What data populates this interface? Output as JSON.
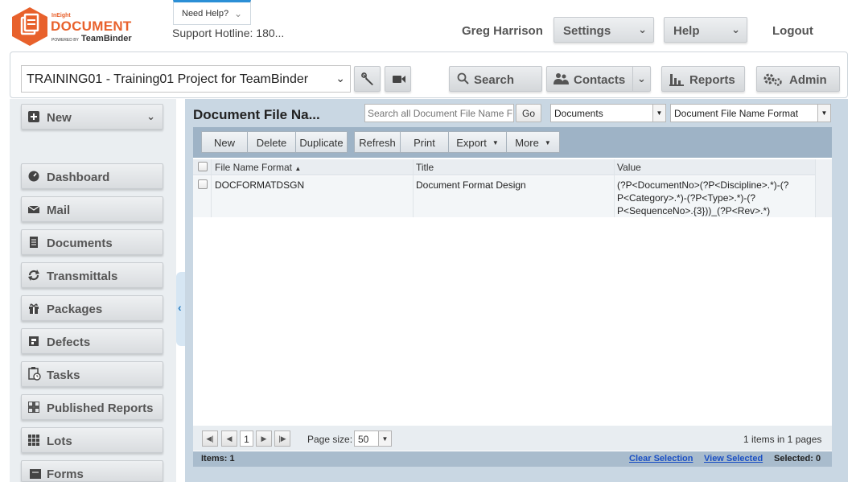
{
  "logo": {
    "small": "InEight",
    "big": "DOCUMENT",
    "powered": "POWERED BY",
    "teambinder": "TeamBinder"
  },
  "help": {
    "need_help": "Need Help?",
    "hotline": "Support Hotline: 180..."
  },
  "header": {
    "user": "Greg Harrison",
    "settings": "Settings",
    "help": "Help",
    "logout": "Logout"
  },
  "project": {
    "selected": "TRAINING01 - Training01 Project for TeamBinder"
  },
  "toolbar_top": {
    "search": "Search",
    "contacts": "Contacts",
    "reports": "Reports",
    "admin": "Admin"
  },
  "sidebar": {
    "new_label": "New",
    "items": [
      {
        "label": "Dashboard",
        "icon": "dashboard-icon"
      },
      {
        "label": "Mail",
        "icon": "mail-icon"
      },
      {
        "label": "Documents",
        "icon": "documents-icon"
      },
      {
        "label": "Transmittals",
        "icon": "transmittals-icon"
      },
      {
        "label": "Packages",
        "icon": "packages-icon"
      },
      {
        "label": "Defects",
        "icon": "defects-icon"
      },
      {
        "label": "Tasks",
        "icon": "tasks-icon"
      },
      {
        "label": "Published Reports",
        "icon": "published-reports-icon"
      },
      {
        "label": "Lots",
        "icon": "lots-icon"
      },
      {
        "label": "Forms",
        "icon": "forms-icon"
      }
    ]
  },
  "main": {
    "title": "Document File Na...",
    "search_placeholder": "Search all Document File Name Fo",
    "go": "Go",
    "module_select": "Documents",
    "view_select": "Document File Name Format"
  },
  "grid_toolbar": {
    "new": "New",
    "delete": "Delete",
    "duplicate": "Duplicate",
    "refresh": "Refresh",
    "print": "Print",
    "export": "Export",
    "more": "More"
  },
  "grid": {
    "columns": [
      "File Name Format",
      "Title",
      "Value"
    ],
    "rows": [
      {
        "file_name_format": "DOCFORMATDSGN",
        "title": "Document Format Design",
        "value_line1": "(?P<DocumentNo>(?P<Discipline>.*)-(?",
        "value_line2": "P<Category>.*)-(?P<Type>.*)-(?",
        "value_line3": "P<SequenceNo>.{3}))_(?P<Rev>.*)"
      }
    ]
  },
  "pager": {
    "current": "1",
    "page_size_label": "Page size:",
    "page_size": "50",
    "info": "1 items in 1 pages"
  },
  "status": {
    "items": "Items: 1",
    "clear_selection": "Clear Selection",
    "view_selected": "View Selected",
    "selected": "Selected: 0"
  },
  "colors": {
    "brand_orange": "#e8612c",
    "panel_blue": "#c9d7e3",
    "toolbar_blue": "#9eb3c6",
    "link_blue": "#1a4fc4"
  }
}
